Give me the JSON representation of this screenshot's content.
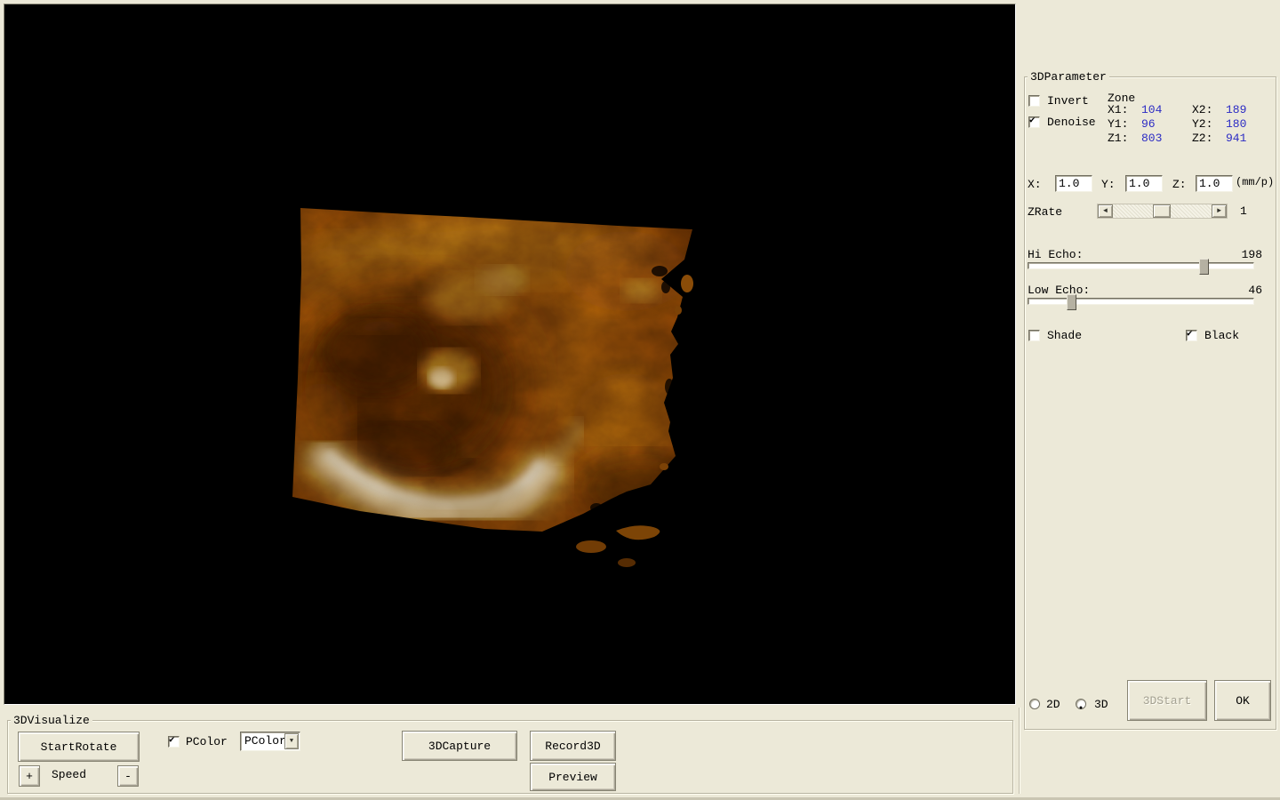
{
  "colors": {
    "background": "#ece9d8",
    "viewport": "#000000",
    "value_blue": "#2b2bc4",
    "volume_amber": "#9a5a0d",
    "volume_dark": "#4e2804",
    "volume_highlight": "#fff8e6"
  },
  "icons": {
    "check": "✔",
    "radio_dot": "●",
    "arrow_left": "◄",
    "arrow_right": "►",
    "dropdown_arrow": "▼"
  },
  "param_panel": {
    "title": "3DParameter",
    "invert": {
      "label": "Invert",
      "checked": false,
      "glyph": ""
    },
    "denoise": {
      "label": "Denoise",
      "checked": true,
      "glyph": "✔"
    },
    "zone": {
      "title": "Zone",
      "rows": [
        {
          "l1": "X1:",
          "v1": "104",
          "l2": "X2:",
          "v2": "189"
        },
        {
          "l1": "Y1:",
          "v1": "96",
          "l2": "Y2:",
          "v2": "180"
        },
        {
          "l1": "Z1:",
          "v1": "803",
          "l2": "Z2:",
          "v2": "941"
        }
      ]
    },
    "scale": {
      "x_label": "X:",
      "x_value": "1.0",
      "y_label": "Y:",
      "y_value": "1.0",
      "z_label": "Z:",
      "z_value": "1.0",
      "unit": "(mm/p)"
    },
    "zrate": {
      "label": "ZRate",
      "value": "1"
    },
    "hi_echo": {
      "label": "Hi Echo:",
      "value": "198"
    },
    "low_echo": {
      "label": "Low Echo:",
      "value": "46"
    },
    "shade": {
      "label": "Shade",
      "checked": false,
      "glyph": ""
    },
    "black": {
      "label": "Black",
      "checked": true,
      "glyph": "✔"
    },
    "mode_2d": {
      "label": "2D",
      "selected": false,
      "dot": ""
    },
    "mode_3d": {
      "label": "3D",
      "selected": true,
      "dot": "●"
    },
    "start_button": "3DStart",
    "ok_button": "OK"
  },
  "visualize_panel": {
    "title": "3DVisualize",
    "start_rotate_button": "StartRotate",
    "speed_plus": "+",
    "speed_label": "Speed",
    "speed_minus": "-",
    "pcolor_checkbox": {
      "label": "PColor",
      "checked": true,
      "glyph": "✔"
    },
    "pcolor_dropdown_value": "PColor",
    "capture_button": "3DCapture",
    "record_button": "Record3D",
    "preview_button": "Preview"
  }
}
